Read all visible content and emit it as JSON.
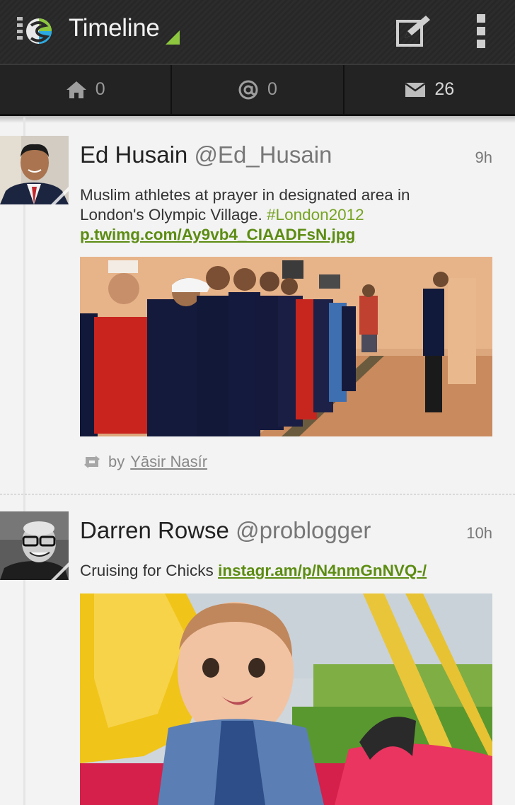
{
  "app": {
    "title": "Timeline"
  },
  "tabs": [
    {
      "icon": "home-icon",
      "count": "0"
    },
    {
      "icon": "at-mention-icon",
      "count": "0"
    },
    {
      "icon": "envelope-icon",
      "count": "26"
    }
  ],
  "tweets": [
    {
      "name": "Ed Husain",
      "handle": "@Ed_Husain",
      "time": "9h",
      "text": "Muslim athletes at prayer in designated area in London's Olympic Village.",
      "hashtag": "#London2012",
      "link": "p.twimg.com/Ay9vb4_CIAADFsN.jpg",
      "retweet_prefix": "by",
      "retweeted_by": "Yāsir Nasír"
    },
    {
      "name": "Darren Rowse",
      "handle": "@problogger",
      "time": "10h",
      "text": "Cruising for Chicks",
      "link": "instagr.am/p/N4nmGnNVQ-/"
    }
  ],
  "colors": {
    "accent_green": "#76a322",
    "link_green": "#5c8c12",
    "actionbar": "#2a2a2a"
  }
}
